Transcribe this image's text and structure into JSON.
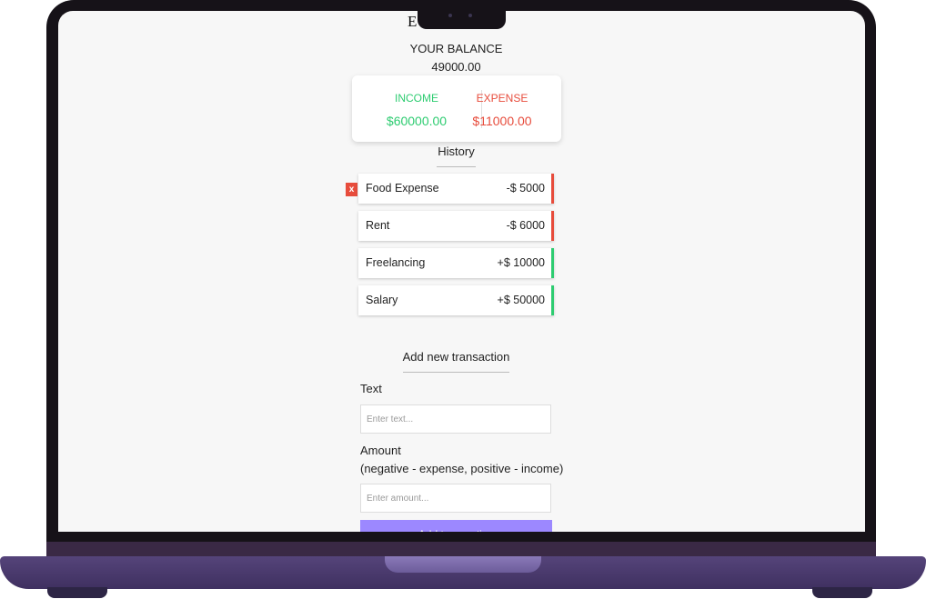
{
  "app": {
    "title_partial": "E"
  },
  "balance": {
    "label": "YOUR BALANCE",
    "value": "49000.00"
  },
  "summary": {
    "income": {
      "label": "INCOME",
      "value": "$60000.00",
      "color": "#2ecc71"
    },
    "expense": {
      "label": "EXPENSE",
      "value": "$11000.00",
      "color": "#e74c3c"
    }
  },
  "history": {
    "title": "History",
    "delete_label": "x",
    "transactions": [
      {
        "text": "Food Expense",
        "amount": "-$ 5000",
        "type": "expense"
      },
      {
        "text": "Rent",
        "amount": "-$ 6000",
        "type": "expense"
      },
      {
        "text": "Freelancing",
        "amount": "+$ 10000",
        "type": "income"
      },
      {
        "text": "Salary",
        "amount": "+$ 50000",
        "type": "income"
      }
    ]
  },
  "form": {
    "title": "Add new transaction",
    "text_label": "Text",
    "text_placeholder": "Enter text...",
    "amount_label": "Amount",
    "amount_hint": "(negative - expense, positive - income)",
    "amount_placeholder": "Enter amount...",
    "submit_label": "Add transaction",
    "button_color": "#9c88ff"
  }
}
